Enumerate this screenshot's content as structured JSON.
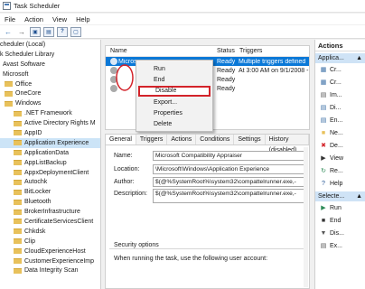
{
  "window": {
    "title": "Task Scheduler"
  },
  "menu": [
    "File",
    "Action",
    "View",
    "Help"
  ],
  "tree": [
    {
      "label": "cheduler (Local)",
      "indent": 0
    },
    {
      "label": "k Scheduler Library",
      "indent": 0
    },
    {
      "label": "Avast Software",
      "indent": 1
    },
    {
      "label": "Microsoft",
      "indent": 1
    },
    {
      "label": "Office",
      "indent": 2,
      "folder": true
    },
    {
      "label": "OneCore",
      "indent": 2,
      "folder": true
    },
    {
      "label": "Windows",
      "indent": 2,
      "folder": true
    },
    {
      "label": ".NET Framework",
      "indent": 3,
      "folder": true
    },
    {
      "label": "Active Directory Rights M",
      "indent": 3,
      "folder": true
    },
    {
      "label": "AppID",
      "indent": 3,
      "folder": true
    },
    {
      "label": "Application Experience",
      "indent": 3,
      "folder": true,
      "selected": true
    },
    {
      "label": "ApplicationData",
      "indent": 3,
      "folder": true
    },
    {
      "label": "AppListBackup",
      "indent": 3,
      "folder": true
    },
    {
      "label": "AppxDeploymentClient",
      "indent": 3,
      "folder": true
    },
    {
      "label": "Autochk",
      "indent": 3,
      "folder": true
    },
    {
      "label": "BitLocker",
      "indent": 3,
      "folder": true
    },
    {
      "label": "Bluetooth",
      "indent": 3,
      "folder": true
    },
    {
      "label": "BrokerInfrastructure",
      "indent": 3,
      "folder": true
    },
    {
      "label": "CertificateServicesClient",
      "indent": 3,
      "folder": true
    },
    {
      "label": "Chkdsk",
      "indent": 3,
      "folder": true
    },
    {
      "label": "Clip",
      "indent": 3,
      "folder": true
    },
    {
      "label": "CloudExperienceHost",
      "indent": 3,
      "folder": true
    },
    {
      "label": "CustomerExperienceImp",
      "indent": 3,
      "folder": true
    },
    {
      "label": "Data Integrity Scan",
      "indent": 3,
      "folder": true
    }
  ],
  "tasklist": {
    "columns": [
      "Name",
      "Status",
      "Triggers"
    ],
    "rows": [
      {
        "name": "Micros",
        "status": "Ready",
        "triggers": "Multiple triggers defined",
        "selected": true
      },
      {
        "name": "",
        "status": "Ready",
        "triggers": "At 3:00 AM on 9/1/2008 -"
      },
      {
        "name": "",
        "status": "Ready",
        "triggers": ""
      },
      {
        "name": "",
        "status": "Ready",
        "triggers": ""
      }
    ]
  },
  "context_menu": [
    "Run",
    "End",
    "Disable",
    "Export...",
    "Properties",
    "Delete"
  ],
  "details": {
    "tabs": [
      "General",
      "Triggers",
      "Actions",
      "Conditions",
      "Settings",
      "History (disabled)"
    ],
    "name_label": "Name:",
    "name_value": "Microsoft Compatibility Appraiser",
    "location_label": "Location:",
    "location_value": "\\Microsoft\\Windows\\Application Experience",
    "author_label": "Author:",
    "author_value": "$(@%SystemRoot%\\system32\\compattelrunner.exe,-",
    "description_label": "Description:",
    "description_value": "$(@%SystemRoot%\\system32\\compattelrunner.exe,-",
    "security_title": "Security options",
    "security_text": "When running the task, use the following user account:"
  },
  "actions": {
    "header": "Actions",
    "group1": "Applica...",
    "group1_items": [
      {
        "label": "Cr...",
        "icon": "create-task-icon"
      },
      {
        "label": "Cr...",
        "icon": "create-basic-task-icon"
      },
      {
        "label": "Im...",
        "icon": "import-icon"
      },
      {
        "label": "Di...",
        "icon": "display-icon"
      },
      {
        "label": "En...",
        "icon": "enable-icon"
      },
      {
        "label": "Ne...",
        "icon": "new-folder-icon"
      },
      {
        "label": "De...",
        "icon": "delete-folder-icon"
      },
      {
        "label": "View",
        "icon": "view-icon"
      },
      {
        "label": "Re...",
        "icon": "refresh-icon"
      },
      {
        "label": "Help",
        "icon": "help-icon"
      }
    ],
    "group2": "Selecte...",
    "group2_items": [
      {
        "label": "Run",
        "icon": "run-icon"
      },
      {
        "label": "End",
        "icon": "end-icon"
      },
      {
        "label": "Dis...",
        "icon": "disable-icon"
      },
      {
        "label": "Ex...",
        "icon": "export-icon"
      }
    ]
  },
  "colors": {
    "selection": "#0a78d7",
    "highlight_box": "#d3232a",
    "tree_selection": "#cce4f7"
  }
}
